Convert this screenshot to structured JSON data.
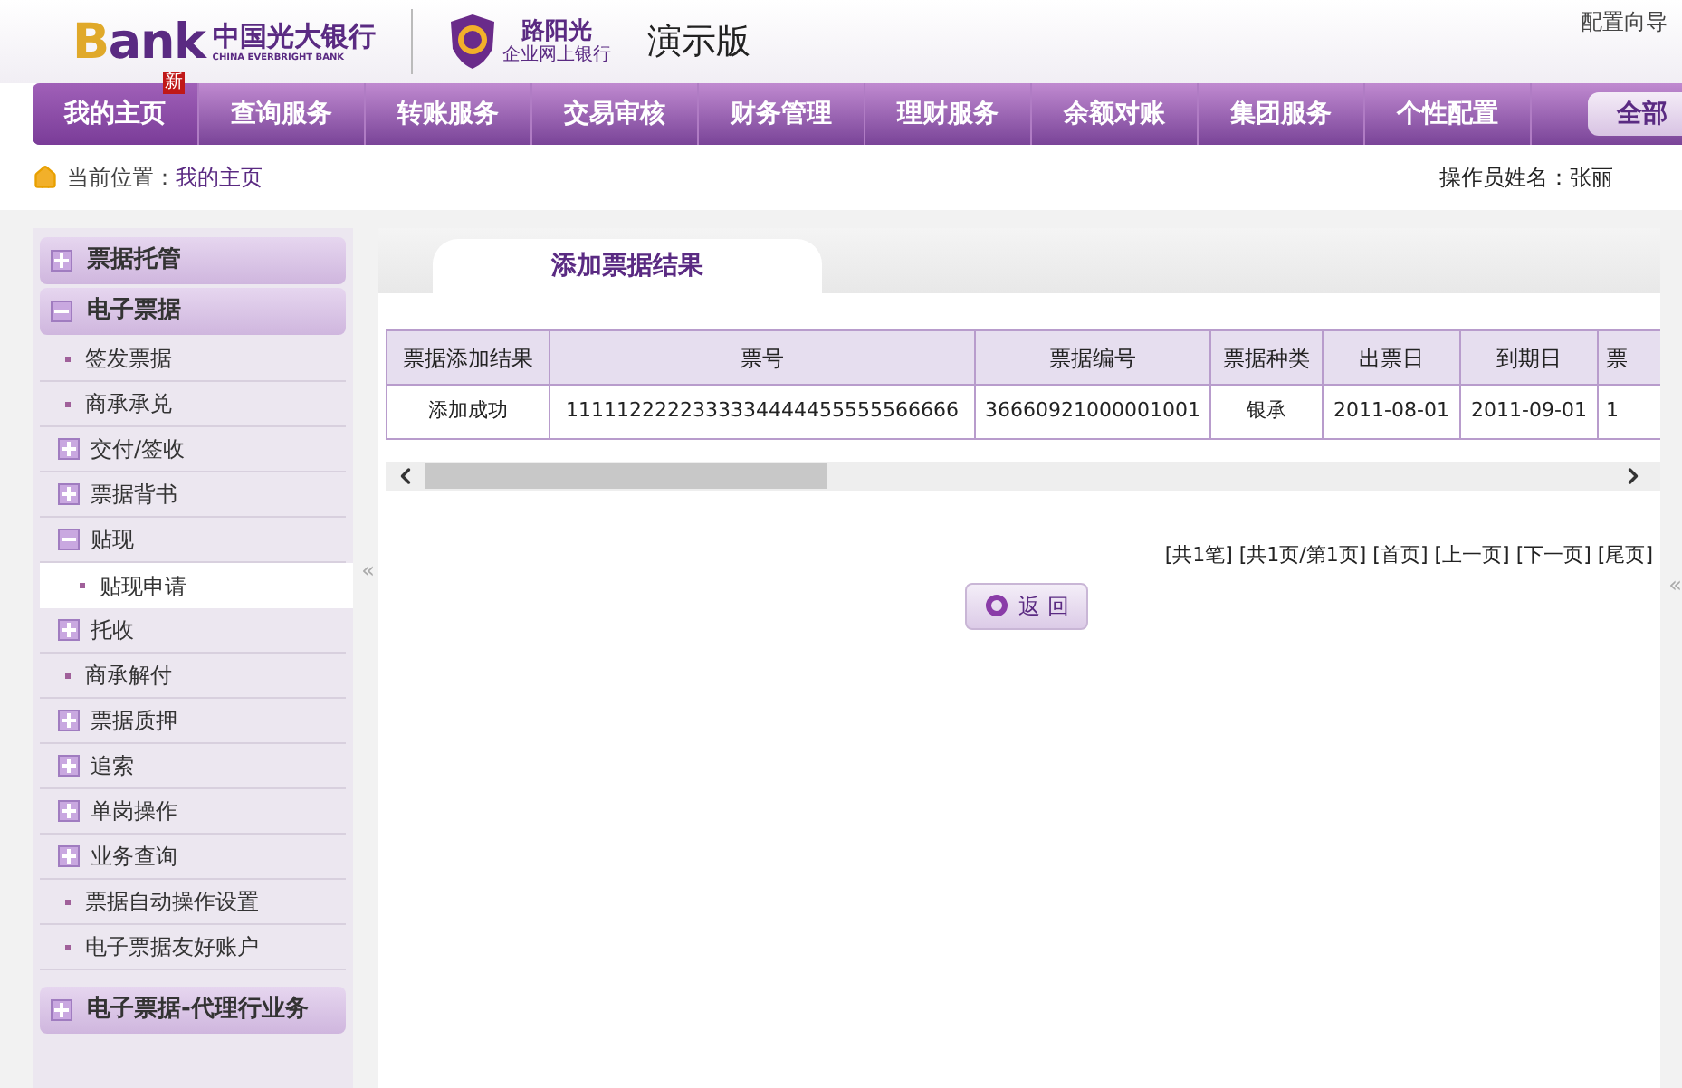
{
  "header": {
    "bank_logo": "Bank",
    "bank_name": "中国光大银行",
    "bank_name_en": "CHINA EVERBRIGHT BANK",
    "brand_name": "路阳光",
    "brand_sub": "企业网上银行",
    "edition": "演示版",
    "config_link": "配置向导"
  },
  "nav": {
    "items": [
      {
        "label": "我的主页",
        "selected": true,
        "badge": "新"
      },
      {
        "label": "查询服务",
        "selected": false
      },
      {
        "label": "转账服务",
        "selected": false
      },
      {
        "label": "交易审核",
        "selected": false
      },
      {
        "label": "财务管理",
        "selected": false
      },
      {
        "label": "理财服务",
        "selected": false
      },
      {
        "label": "余额对账",
        "selected": false
      },
      {
        "label": "集团服务",
        "selected": false
      },
      {
        "label": "个性配置",
        "selected": false
      }
    ],
    "all_button": "全部"
  },
  "breadcrumb": {
    "label": "当前位置：",
    "current": "我的主页"
  },
  "operator": "操作员姓名：张丽",
  "sidebar": {
    "items": [
      {
        "kind": "group",
        "label": "票据托管",
        "expanded": false
      },
      {
        "kind": "group",
        "label": "电子票据",
        "expanded": true,
        "children": [
          {
            "kind": "leaf",
            "label": "签发票据",
            "selected": false
          },
          {
            "kind": "leaf",
            "label": "商承承兑",
            "selected": false
          },
          {
            "kind": "folder",
            "label": "交付/签收",
            "expanded": false
          },
          {
            "kind": "folder",
            "label": "票据背书",
            "expanded": false
          },
          {
            "kind": "folder",
            "label": "贴现",
            "expanded": true,
            "children": [
              {
                "kind": "leaf",
                "label": "贴现申请",
                "selected": true
              }
            ]
          },
          {
            "kind": "folder",
            "label": "托收",
            "expanded": false
          },
          {
            "kind": "leaf",
            "label": "商承解付",
            "selected": false
          },
          {
            "kind": "folder",
            "label": "票据质押",
            "expanded": false
          },
          {
            "kind": "folder",
            "label": "追索",
            "expanded": false
          },
          {
            "kind": "folder",
            "label": "单岗操作",
            "expanded": false
          },
          {
            "kind": "folder",
            "label": "业务查询",
            "expanded": false
          },
          {
            "kind": "leaf",
            "label": "票据自动操作设置",
            "selected": false
          },
          {
            "kind": "leaf",
            "label": "电子票据友好账户",
            "selected": false
          }
        ]
      },
      {
        "kind": "group",
        "label": "电子票据-代理行业务",
        "expanded": false
      }
    ],
    "collapse_handle": "«"
  },
  "main": {
    "tab": "添加票据结果",
    "table": {
      "columns": [
        "票据添加结果",
        "票号",
        "票据编号",
        "票据种类",
        "出票日",
        "到期日",
        "票"
      ],
      "rows": [
        [
          "添加成功",
          "1111122222333334444455555566666",
          "36660921000001001",
          "银承",
          "2011-08-01",
          "2011-09-01",
          "1"
        ]
      ]
    },
    "pager": "[共1笔] [共1页/第1页] [首页] [上一页] [下一页] [尾页]",
    "back_button": "返 回",
    "right_handle": "«"
  }
}
